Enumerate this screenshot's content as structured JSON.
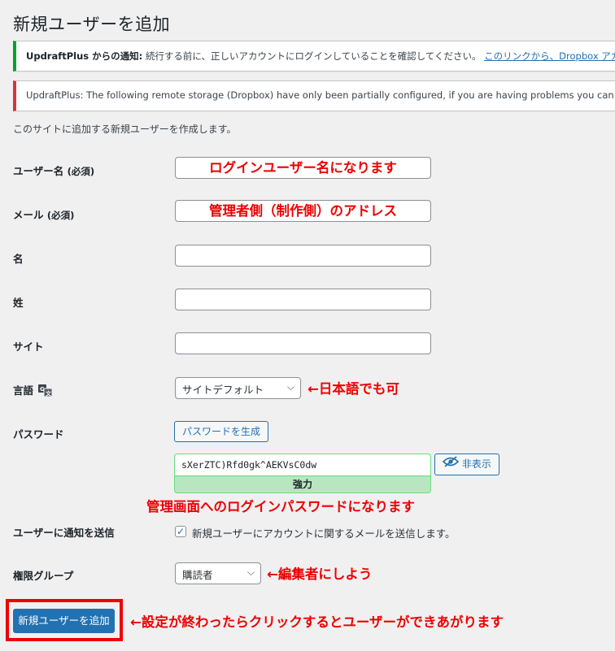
{
  "page": {
    "title": "新規ユーザーを追加"
  },
  "notices": {
    "green": {
      "prefix": "UpdraftPlus からの通知:",
      "text": " 続行する前に、正しいアカウントにログインしていることを確認してください。 ",
      "link": "このリンクから、Dropbox アカウ"
    },
    "red": {
      "text": "UpdraftPlus: The following remote storage (Dropbox) have only been partially configured, if you are having problems you can try to manually"
    }
  },
  "intro": "このサイトに追加する新規ユーザーを作成します。",
  "fields": {
    "username": {
      "label": "ユーザー名",
      "req": "(必須)",
      "annotation": "ログインユーザー名になります"
    },
    "email": {
      "label": "メール",
      "req": "(必須)",
      "annotation": "管理者側（制作側）のアドレス"
    },
    "first_name": {
      "label": "名",
      "value": ""
    },
    "last_name": {
      "label": "姓",
      "value": ""
    },
    "website": {
      "label": "サイト",
      "value": ""
    },
    "language": {
      "label": "言語",
      "selected": "サイトデフォルト",
      "annotation": "←日本語でも可"
    },
    "password": {
      "label": "パスワード",
      "generate_label": "パスワードを生成",
      "value": "sXerZTC)Rfd0gk^AEKVsC0dw",
      "hide_label": "非表示",
      "strength": "強力",
      "annotation": "管理画面へのログインパスワードになります"
    },
    "notify": {
      "label": "ユーザーに通知を送信",
      "checkbox_label": "新規ユーザーにアカウントに関するメールを送信します。",
      "checked": true
    },
    "role": {
      "label": "権限グループ",
      "selected": "購読者",
      "annotation": "←編集者にしよう"
    }
  },
  "submit": {
    "label": "新規ユーザーを追加",
    "annotation": "←設定が終わったらクリックするとユーザーができあがります"
  },
  "colors": {
    "primary": "#2271b1",
    "annotation_red": "#e00000",
    "notice_green": "#00a32a",
    "notice_red": "#d63638",
    "strength_bg": "#b8e6bf"
  }
}
